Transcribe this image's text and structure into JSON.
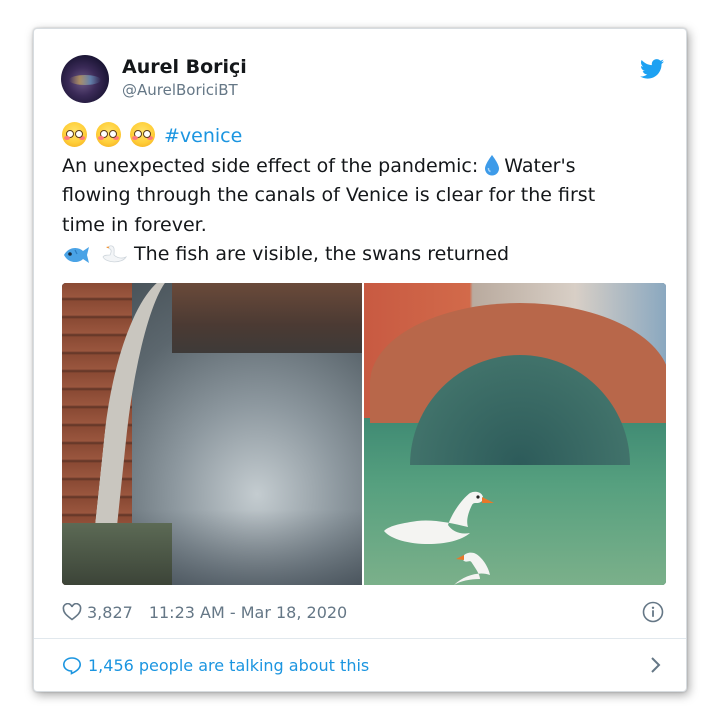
{
  "tweet": {
    "author_name": "Aurel Boriçi",
    "author_handle": "@AurelBoriciBT",
    "hashtag": "#venice",
    "line1": "An unexpected side effect of the pandemic:",
    "line1_after_drop": "Water's",
    "line2": "flowing through the canals of Venice is clear for the first",
    "line3": "time in forever.",
    "line4": "The fish are visible, the swans returned",
    "icons": {
      "brand": "twitter-bird-icon",
      "emoji_flushed": "flushed-face-emoji",
      "emoji_drop": "droplet-emoji",
      "emoji_fish": "fish-emoji",
      "emoji_swan": "swan-emoji",
      "like": "heart-icon",
      "info": "info-icon",
      "reply": "speech-bubble-icon",
      "more": "chevron-right-icon"
    },
    "likes": "3,827",
    "timestamp": "11:23 AM - Mar 18, 2020",
    "talking": "1,456 people are talking about this"
  },
  "colors": {
    "link": "#1b95e0",
    "muted": "#657786",
    "text": "#14171a",
    "border": "#e1e8ed"
  }
}
